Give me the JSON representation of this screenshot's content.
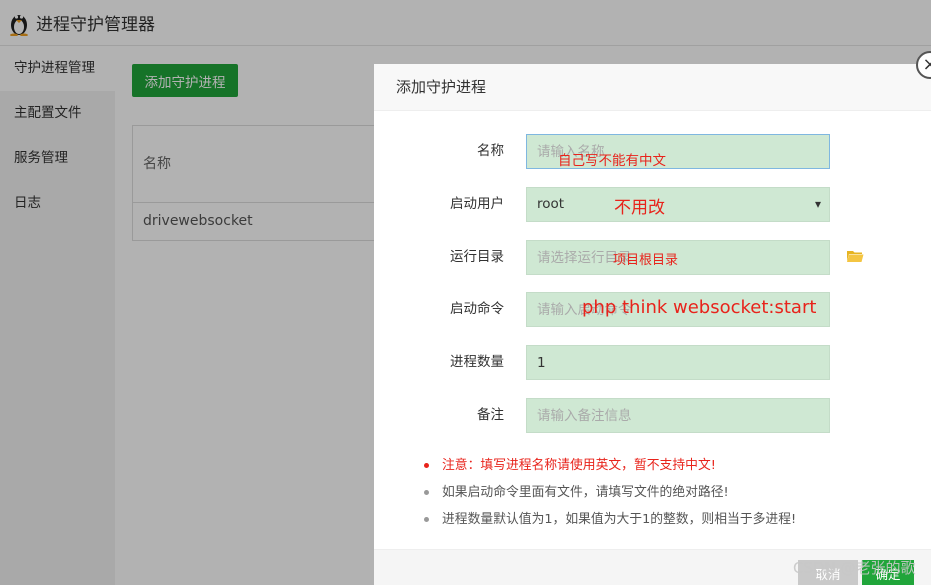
{
  "app": {
    "title": "进程守护管理器"
  },
  "sidebar": {
    "items": [
      {
        "label": "守护进程管理"
      },
      {
        "label": "主配置文件"
      },
      {
        "label": "服务管理"
      },
      {
        "label": "日志"
      }
    ]
  },
  "main": {
    "add_button": "添加守护进程",
    "table": {
      "header": "名称",
      "rows": [
        "drivewebsocket"
      ]
    }
  },
  "dialog": {
    "title": "添加守护进程",
    "close": "×",
    "fields": {
      "name": {
        "label": "名称",
        "placeholder": "请输入名称",
        "note": "自己写不能有中文"
      },
      "user": {
        "label": "启动用户",
        "value": "root",
        "note": "不用改"
      },
      "dir": {
        "label": "运行目录",
        "placeholder": "请选择运行目录",
        "note": "项目根目录"
      },
      "cmd": {
        "label": "启动命令",
        "placeholder": "请输入启动命令",
        "note": "php think websocket:start"
      },
      "count": {
        "label": "进程数量",
        "value": "1"
      },
      "remark": {
        "label": "备注",
        "placeholder": "请输入备注信息"
      }
    },
    "tips": [
      "注意：填写进程名称请使用英文，暂不支持中文!",
      "如果启动命令里面有文件，请填写文件的绝对路径!",
      "进程数量默认值为1，如果值为大于1的整数，则相当于多进程!"
    ],
    "cancel": "取消",
    "ok": "确定"
  },
  "watermark": "CSDN @老张的歌",
  "colors": {
    "accent": "#20a53a",
    "note": "#e8231b",
    "field_bg": "#cfe8d3"
  }
}
